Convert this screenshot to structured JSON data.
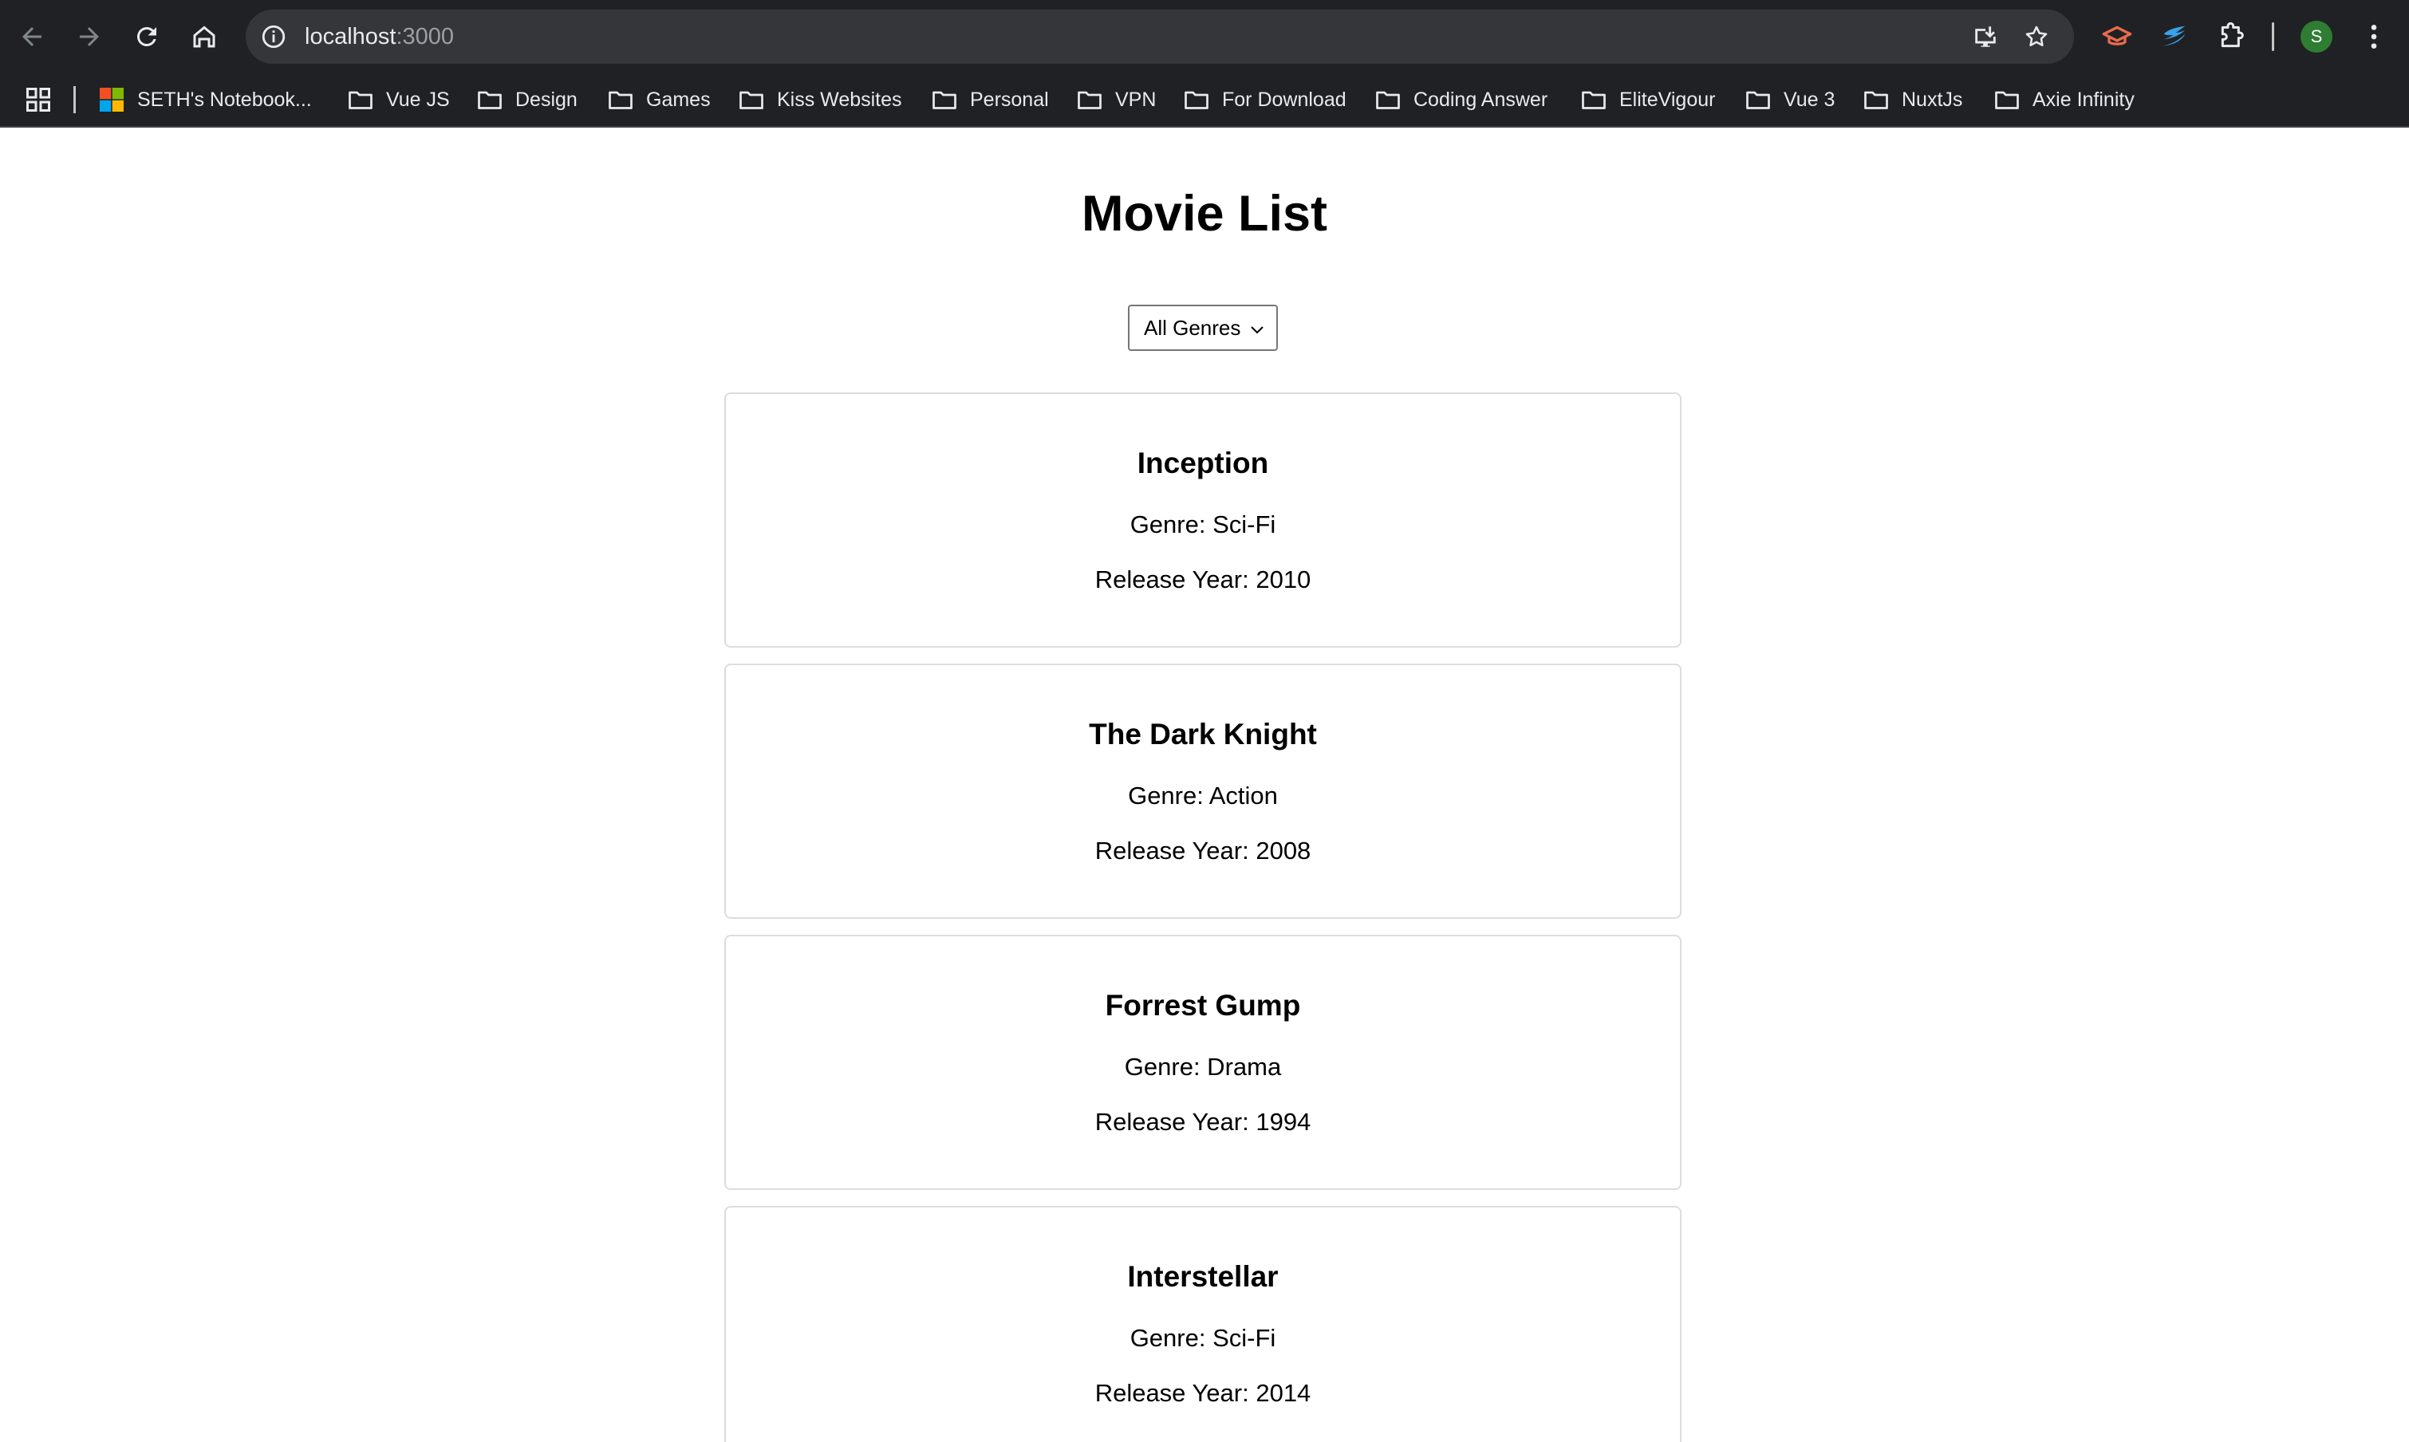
{
  "browser": {
    "url_host": "localhost",
    "url_port": ":3000",
    "avatar_initial": "S",
    "bookmarks": [
      {
        "label": "SETH's Notebook..."
      },
      {
        "label": "Vue JS"
      },
      {
        "label": "Design"
      },
      {
        "label": "Games"
      },
      {
        "label": "Kiss Websites"
      },
      {
        "label": "Personal"
      },
      {
        "label": "VPN"
      },
      {
        "label": "For Download"
      },
      {
        "label": "Coding Answer"
      },
      {
        "label": "EliteVigour"
      },
      {
        "label": "Vue 3"
      },
      {
        "label": "NuxtJs"
      },
      {
        "label": "Axie Infinity"
      }
    ]
  },
  "page": {
    "title": "Movie List",
    "genre_filter": {
      "selected": "All Genres"
    },
    "movies": [
      {
        "title": "Inception",
        "genre": "Genre: Sci-Fi",
        "year": "Release Year: 2010"
      },
      {
        "title": "The Dark Knight",
        "genre": "Genre: Action",
        "year": "Release Year: 2008"
      },
      {
        "title": "Forrest Gump",
        "genre": "Genre: Drama",
        "year": "Release Year: 1994"
      },
      {
        "title": "Interstellar",
        "genre": "Genre: Sci-Fi",
        "year": "Release Year: 2014"
      }
    ]
  },
  "colors": {
    "chrome_bg": "#202124",
    "omnibox_bg": "#35363a",
    "card_border": "#dddddd"
  }
}
